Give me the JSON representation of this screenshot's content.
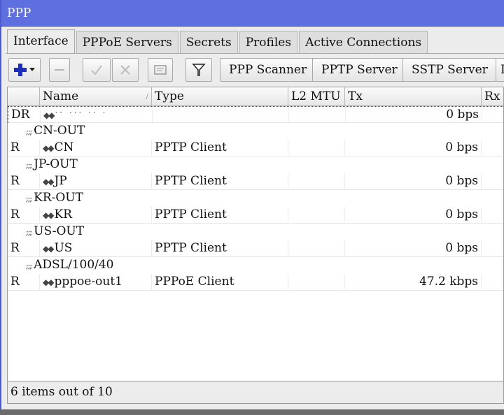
{
  "window": {
    "title": "PPP"
  },
  "tabs": [
    "Interface",
    "PPPoE Servers",
    "Secrets",
    "Profiles",
    "Active Connections"
  ],
  "toolbar": {
    "ppp_scanner": "PPP Scanner",
    "pptp_server": "PPTP Server",
    "sstp_server": "SSTP Server",
    "next_button_partial": "L",
    "icons": [
      "plus-icon",
      "chevron-down-icon",
      "minus-icon",
      "check-icon",
      "cross-icon",
      "comment-icon",
      "filter-icon"
    ]
  },
  "columns": [
    "Name",
    "Type",
    "L2 MTU",
    "Tx",
    "Rx"
  ],
  "rows": [
    {
      "kind": "data",
      "flags": "DR",
      "name": "",
      "type": "",
      "l2mtu": "",
      "tx": "0 bps",
      "rx": ""
    },
    {
      "kind": "comment",
      "text": "CN-OUT"
    },
    {
      "kind": "data",
      "flags": "R",
      "name": "CN",
      "type": "PPTP Client",
      "l2mtu": "",
      "tx": "0 bps",
      "rx": ""
    },
    {
      "kind": "comment",
      "text": "JP-OUT"
    },
    {
      "kind": "data",
      "flags": "R",
      "name": "JP",
      "type": "PPTP Client",
      "l2mtu": "",
      "tx": "0 bps",
      "rx": ""
    },
    {
      "kind": "comment",
      "text": "KR-OUT"
    },
    {
      "kind": "data",
      "flags": "R",
      "name": "KR",
      "type": "PPTP Client",
      "l2mtu": "",
      "tx": "0 bps",
      "rx": ""
    },
    {
      "kind": "comment",
      "text": "US-OUT"
    },
    {
      "kind": "data",
      "flags": "R",
      "name": "US",
      "type": "PPTP Client",
      "l2mtu": "",
      "tx": "0 bps",
      "rx": ""
    },
    {
      "kind": "comment",
      "text": "ADSL/100/40"
    },
    {
      "kind": "data",
      "flags": "R",
      "name": "pppoe-out1",
      "type": "PPPoE Client",
      "l2mtu": "",
      "tx": "47.2 kbps",
      "rx": ""
    }
  ],
  "status": {
    "text": "6 items out of 10"
  }
}
